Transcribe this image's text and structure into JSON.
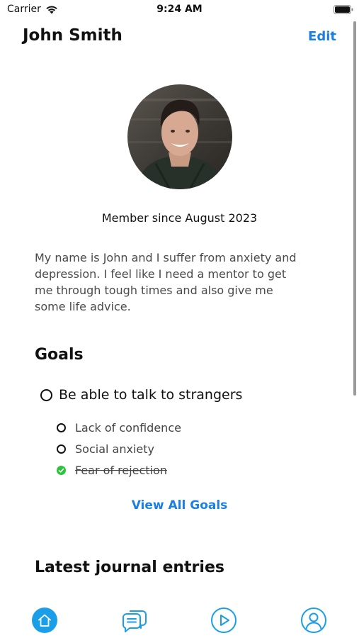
{
  "status_bar": {
    "carrier": "Carrier",
    "time": "9:24 AM"
  },
  "header": {
    "title": "John Smith",
    "edit_label": "Edit"
  },
  "profile": {
    "avatar_alt": "profile photo",
    "member_since": "Member since August 2023",
    "bio": "My name is John and I suffer from anxiety and depression. I feel like I need a mentor to get me through tough times and also give me some life advice."
  },
  "goals": {
    "title": "Goals",
    "main_goal": {
      "label": "Be able to talk to strangers",
      "completed": false
    },
    "sub_goals": [
      {
        "label": "Lack of confidence",
        "completed": false
      },
      {
        "label": "Social anxiety",
        "completed": false
      },
      {
        "label": "Fear of rejection",
        "completed": true
      }
    ],
    "view_all_label": "View All Goals"
  },
  "journal": {
    "title": "Latest journal entries"
  },
  "tab_bar": {
    "tabs": [
      {
        "icon": "home-icon",
        "active": true
      },
      {
        "icon": "chat-icon",
        "active": false
      },
      {
        "icon": "play-icon",
        "active": false
      },
      {
        "icon": "profile-icon",
        "active": false
      }
    ]
  },
  "colors": {
    "accent": "#1a7fe0",
    "tab_active": "#1a9ee8",
    "check_green": "#2ec33d"
  }
}
